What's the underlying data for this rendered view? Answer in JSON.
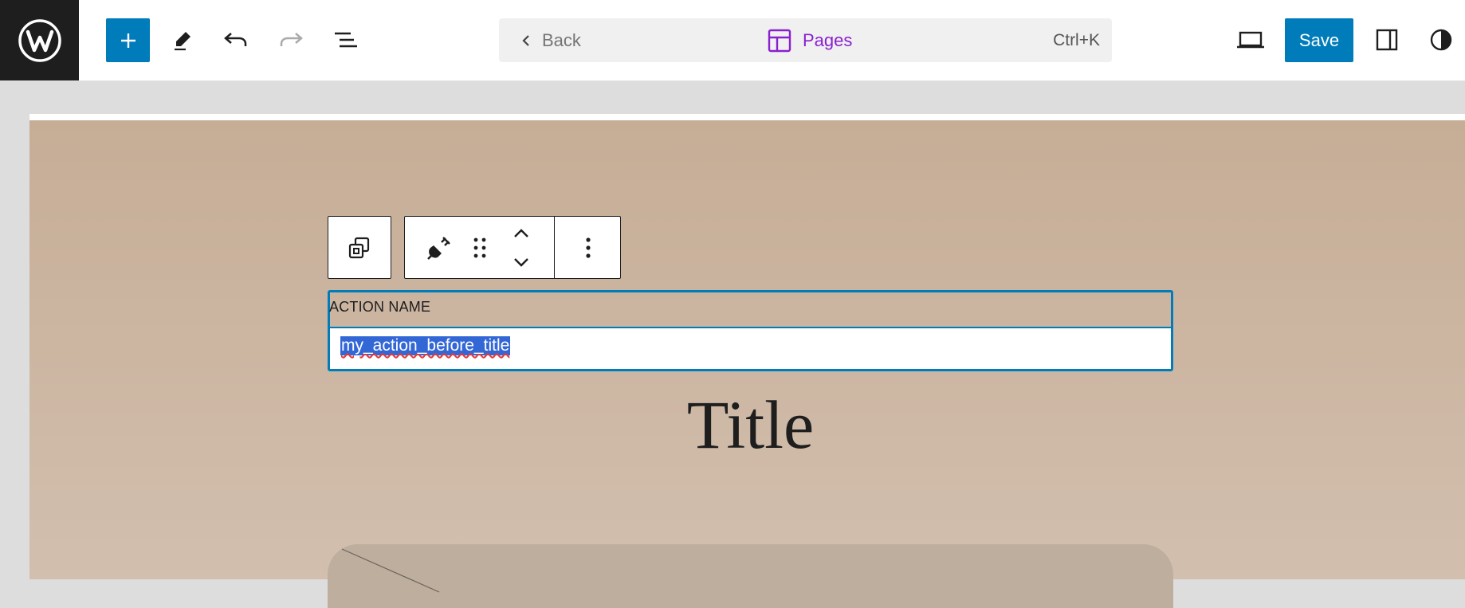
{
  "toolbar": {
    "icons": {
      "logo": "wordpress-logo",
      "add": "plus-icon",
      "tools": "pencil-icon",
      "undo": "undo-icon",
      "redo": "redo-icon",
      "outline": "list-view-icon",
      "view": "desktop-icon",
      "sidebar": "sidebar-toggle-icon",
      "styles": "half-circle-contrast-icon"
    },
    "command_bar": {
      "back_label": "Back",
      "center_label": "Pages",
      "shortcut": "Ctrl+K"
    },
    "save_label": "Save"
  },
  "block_toolbar": {
    "icons": [
      "transform-icon",
      "plug-icon",
      "drag-handle-icon",
      "move-up-icon",
      "move-down-icon",
      "more-options-icon"
    ]
  },
  "action_block": {
    "label": "ACTION NAME",
    "value": "my_action_before_title"
  },
  "page": {
    "title": "Title"
  },
  "colors": {
    "accent": "#007cba",
    "command_center": "#8a1fcf",
    "selection": "#3367d6",
    "canvas_top": "#c6ad96",
    "canvas_bottom": "#d2bfae"
  }
}
